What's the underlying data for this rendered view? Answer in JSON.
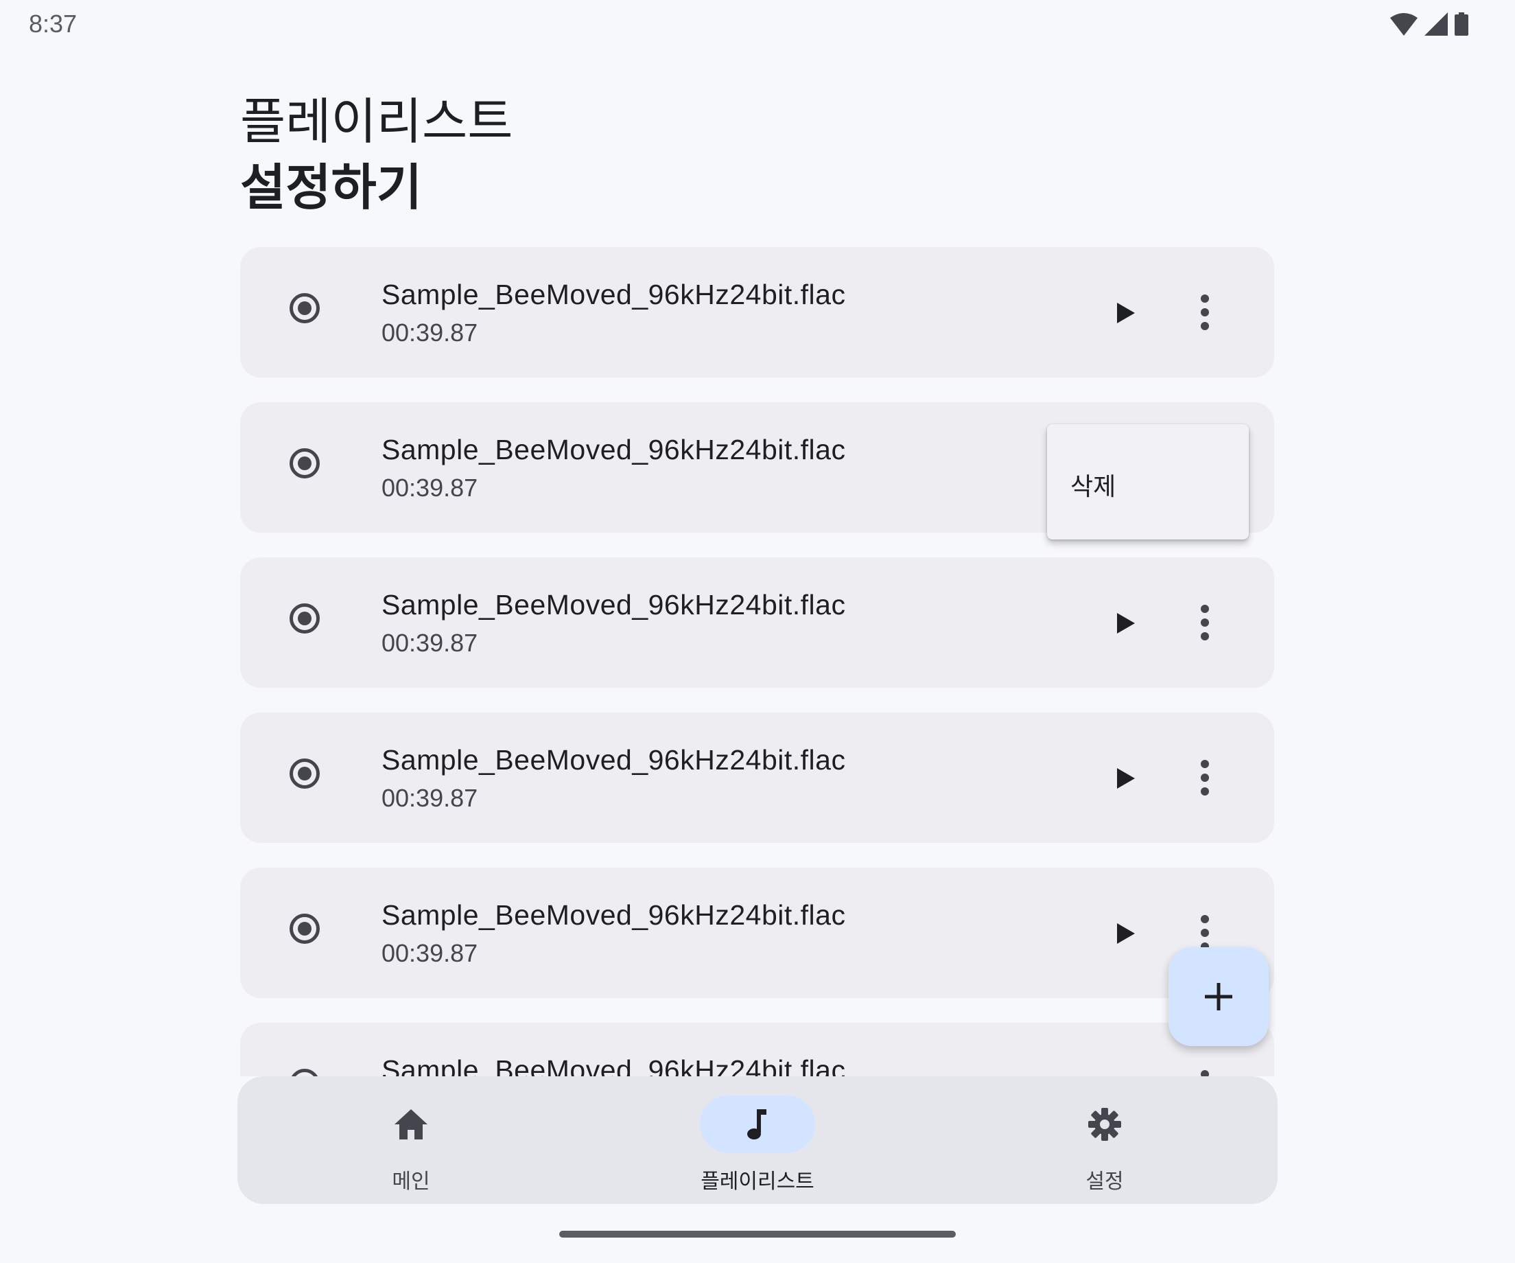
{
  "status_bar": {
    "time": "8:37"
  },
  "header": {
    "title_line1": "플레이리스트",
    "title_line2": "설정하기"
  },
  "tracks": [
    {
      "title": "Sample_BeeMoved_96kHz24bit.flac",
      "duration": "00:39.87"
    },
    {
      "title": "Sample_BeeMoved_96kHz24bit.flac",
      "duration": "00:39.87"
    },
    {
      "title": "Sample_BeeMoved_96kHz24bit.flac",
      "duration": "00:39.87"
    },
    {
      "title": "Sample_BeeMoved_96kHz24bit.flac",
      "duration": "00:39.87"
    },
    {
      "title": "Sample_BeeMoved_96kHz24bit.flac",
      "duration": "00:39.87"
    },
    {
      "title": "Sample_BeeMoved_96kHz24bit.flac",
      "duration": ""
    }
  ],
  "context_menu": {
    "delete_label": "삭제"
  },
  "fab": {
    "icon": "add-icon"
  },
  "bottom_nav": {
    "items": [
      {
        "label": "메인",
        "icon": "home-icon",
        "active": false
      },
      {
        "label": "플레이리스트",
        "icon": "music-note-icon",
        "active": true
      },
      {
        "label": "설정",
        "icon": "settings-icon",
        "active": false
      }
    ]
  },
  "colors": {
    "accent": "#d2e4ff",
    "card": "#ededf2",
    "background": "#f7f8fc"
  }
}
